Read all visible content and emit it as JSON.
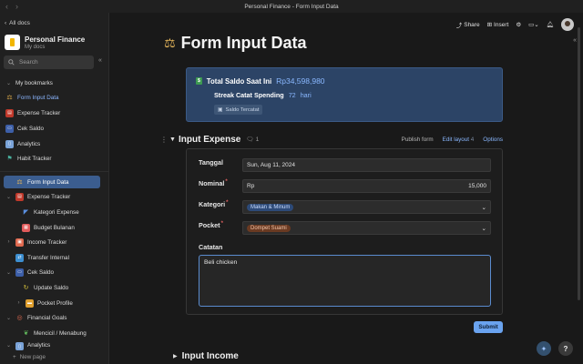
{
  "window": {
    "title": "Personal Finance - Form Input Data"
  },
  "sidebar": {
    "all_docs": "All docs",
    "workspace": {
      "name": "Personal Finance",
      "sub": "My docs"
    },
    "search_placeholder": "Search",
    "bookmarks_label": "My bookmarks",
    "bookmarks": [
      {
        "label": "Form Input Data"
      },
      {
        "label": "Expense Tracker"
      },
      {
        "label": "Cek Saldo"
      },
      {
        "label": "Analytics"
      },
      {
        "label": "Habit Tracker"
      }
    ],
    "pages": [
      {
        "label": "Form Input Data"
      },
      {
        "label": "Expense Tracker"
      },
      {
        "label": "Kategori Expense"
      },
      {
        "label": "Budget Bulanan"
      },
      {
        "label": "Income Tracker"
      },
      {
        "label": "Transfer Internal"
      },
      {
        "label": "Cek Saldo"
      },
      {
        "label": "Update Saldo"
      },
      {
        "label": "Pocket Profile"
      },
      {
        "label": "Financial Goals"
      },
      {
        "label": "Mencicil / Menabung"
      },
      {
        "label": "Analytics"
      }
    ],
    "new_page": "New page"
  },
  "toolbar": {
    "share": "Share",
    "insert": "Insert"
  },
  "page": {
    "title": "Form Input Data",
    "saldo": {
      "label": "Total Saldo Saat Ini",
      "value": "Rp34,598,980",
      "streak_label": "Streak Catat Spending",
      "streak_value": "72",
      "streak_unit": "hari",
      "chip": "Saldo Tercatat"
    },
    "section": {
      "name": "Input Expense",
      "comments": "1",
      "publish": "Publish form",
      "edit_layout": "Edit layout",
      "edit_layout_count": "4",
      "options": "Options"
    },
    "form": {
      "tanggal_label": "Tanggal",
      "tanggal_value": "Sun, Aug 11, 2024",
      "nominal_label": "Nominal",
      "nominal_prefix": "Rp",
      "nominal_value": "15,000",
      "kategori_label": "Kategori",
      "kategori_value": "Makan & Minum",
      "pocket_label": "Pocket",
      "pocket_value": "Dompet Suami",
      "catatan_label": "Catatan",
      "catatan_value": "Beli chicken",
      "submit": "Submit"
    },
    "section2": {
      "name": "Input Income"
    }
  },
  "colors": {
    "accent": "#6aa3ef",
    "card": "#2c4466",
    "active_nav": "#3b5d8f"
  }
}
